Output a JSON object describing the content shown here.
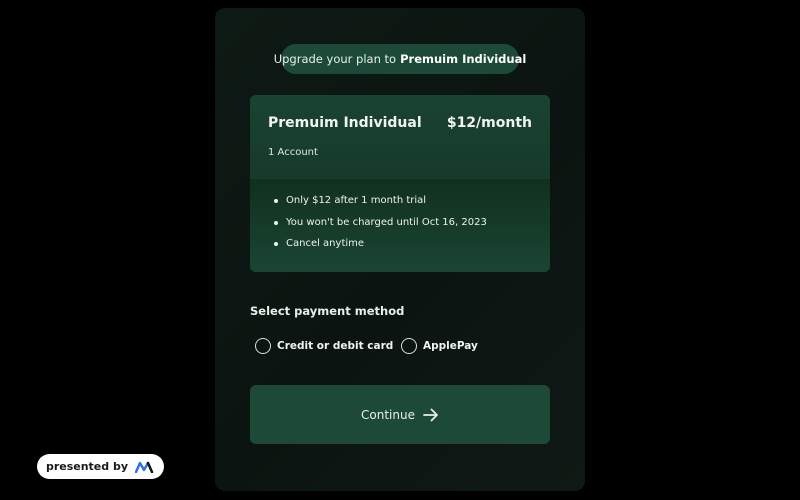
{
  "header": {
    "upgrade_prefix": "Upgrade your plan to",
    "upgrade_plan": "Premuim Individual"
  },
  "plan": {
    "name": "Premuim Individual",
    "price": "$12/month",
    "accounts": "1 Account",
    "features": [
      "Only $12 after 1 month trial",
      "You won't be charged until Oct 16, 2023",
      "Cancel anytime"
    ]
  },
  "payment": {
    "heading": "Select payment method",
    "options": [
      {
        "label": "Credit or debit card",
        "selected": false
      },
      {
        "label": "ApplePay",
        "selected": false
      }
    ]
  },
  "continue_button": {
    "label": "Continue",
    "icon": "arrow-right-icon"
  },
  "badge": {
    "label": "presented by",
    "icon": "brand-logo-icon"
  },
  "colors": {
    "background": "#000000",
    "modal": "#0e1a15",
    "accent": "#1c4a37",
    "card": "#16392b",
    "logo": "#2f6fe4"
  }
}
